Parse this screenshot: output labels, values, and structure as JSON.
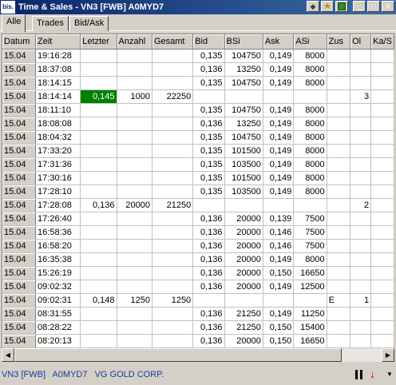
{
  "window": {
    "title": "Time & Sales - VN3 [FWB]  A0MYD7",
    "app_icon_text": "bis.",
    "buttons": {
      "pin_icon": "pin-icon",
      "star_icon": "star-icon",
      "green_icon": "indicator-icon",
      "minimize": "_",
      "maximize": "□",
      "close": "X"
    }
  },
  "tabs": [
    "Alle",
    "Trades",
    "Bid/Ask"
  ],
  "active_tab": "Alle",
  "table": {
    "columns": [
      "Datum",
      "Zeit",
      "Letzter",
      "Anzahl",
      "Gesamt",
      "Bid",
      "BSi",
      "Ask",
      "ASi",
      "Zus",
      "Ol",
      "Ka/S"
    ],
    "rows": [
      [
        "15.04",
        "19:16:28",
        "",
        "",
        "",
        "0,135",
        "104750",
        "0,149",
        "8000",
        "",
        "",
        ""
      ],
      [
        "15.04",
        "18:37:08",
        "",
        "",
        "",
        "0,136",
        "13250",
        "0,149",
        "8000",
        "",
        "",
        ""
      ],
      [
        "15.04",
        "18:14:15",
        "",
        "",
        "",
        "0,135",
        "104750",
        "0,149",
        "8000",
        "",
        "",
        ""
      ],
      [
        "15.04",
        "18:14:14",
        "0,145",
        "1000",
        "22250",
        "",
        "",
        "",
        "",
        "",
        "3",
        ""
      ],
      [
        "15.04",
        "18:11:10",
        "",
        "",
        "",
        "0,135",
        "104750",
        "0,149",
        "8000",
        "",
        "",
        ""
      ],
      [
        "15.04",
        "18:08:08",
        "",
        "",
        "",
        "0,136",
        "13250",
        "0,149",
        "8000",
        "",
        "",
        ""
      ],
      [
        "15.04",
        "18:04:32",
        "",
        "",
        "",
        "0,135",
        "104750",
        "0,149",
        "8000",
        "",
        "",
        ""
      ],
      [
        "15.04",
        "17:33:20",
        "",
        "",
        "",
        "0,135",
        "101500",
        "0,149",
        "8000",
        "",
        "",
        ""
      ],
      [
        "15.04",
        "17:31:36",
        "",
        "",
        "",
        "0,135",
        "103500",
        "0,149",
        "8000",
        "",
        "",
        ""
      ],
      [
        "15.04",
        "17:30:16",
        "",
        "",
        "",
        "0,135",
        "101500",
        "0,149",
        "8000",
        "",
        "",
        ""
      ],
      [
        "15.04",
        "17:28:10",
        "",
        "",
        "",
        "0,135",
        "103500",
        "0,149",
        "8000",
        "",
        "",
        ""
      ],
      [
        "15.04",
        "17:28:08",
        "0,136",
        "20000",
        "21250",
        "",
        "",
        "",
        "",
        "",
        "2",
        ""
      ],
      [
        "15.04",
        "17:26:40",
        "",
        "",
        "",
        "0,136",
        "20000",
        "0,139",
        "7500",
        "",
        "",
        ""
      ],
      [
        "15.04",
        "16:58:36",
        "",
        "",
        "",
        "0,136",
        "20000",
        "0,146",
        "7500",
        "",
        "",
        ""
      ],
      [
        "15.04",
        "16:58:20",
        "",
        "",
        "",
        "0,136",
        "20000",
        "0,146",
        "7500",
        "",
        "",
        ""
      ],
      [
        "15.04",
        "16:35:38",
        "",
        "",
        "",
        "0,136",
        "20000",
        "0,149",
        "8000",
        "",
        "",
        ""
      ],
      [
        "15.04",
        "15:26:19",
        "",
        "",
        "",
        "0,136",
        "20000",
        "0,150",
        "16650",
        "",
        "",
        ""
      ],
      [
        "15.04",
        "09:02:32",
        "",
        "",
        "",
        "0,136",
        "20000",
        "0,149",
        "12500",
        "",
        "",
        ""
      ],
      [
        "15.04",
        "09:02:31",
        "0,148",
        "1250",
        "1250",
        "",
        "",
        "",
        "",
        "E",
        "1",
        ""
      ],
      [
        "15.04",
        "08:31:55",
        "",
        "",
        "",
        "0,136",
        "21250",
        "0,149",
        "11250",
        "",
        "",
        ""
      ],
      [
        "15.04",
        "08:28:22",
        "",
        "",
        "",
        "0,136",
        "21250",
        "0,150",
        "15400",
        "",
        "",
        ""
      ],
      [
        "15.04",
        "08:20:13",
        "",
        "",
        "",
        "0,136",
        "20000",
        "0,150",
        "16650",
        "",
        "",
        ""
      ]
    ],
    "highlight": {
      "row": 3,
      "col": 2,
      "color": "#008000"
    }
  },
  "status": {
    "symbol": "VN3 [FWB]",
    "isin": "A0MYD7",
    "name": "VG GOLD CORP.",
    "color": "#1a3aa0",
    "pause_icon": "pause-icon",
    "down_icon": "down-arrow-icon",
    "dropdown_icon": "dropdown-arrow-icon"
  }
}
